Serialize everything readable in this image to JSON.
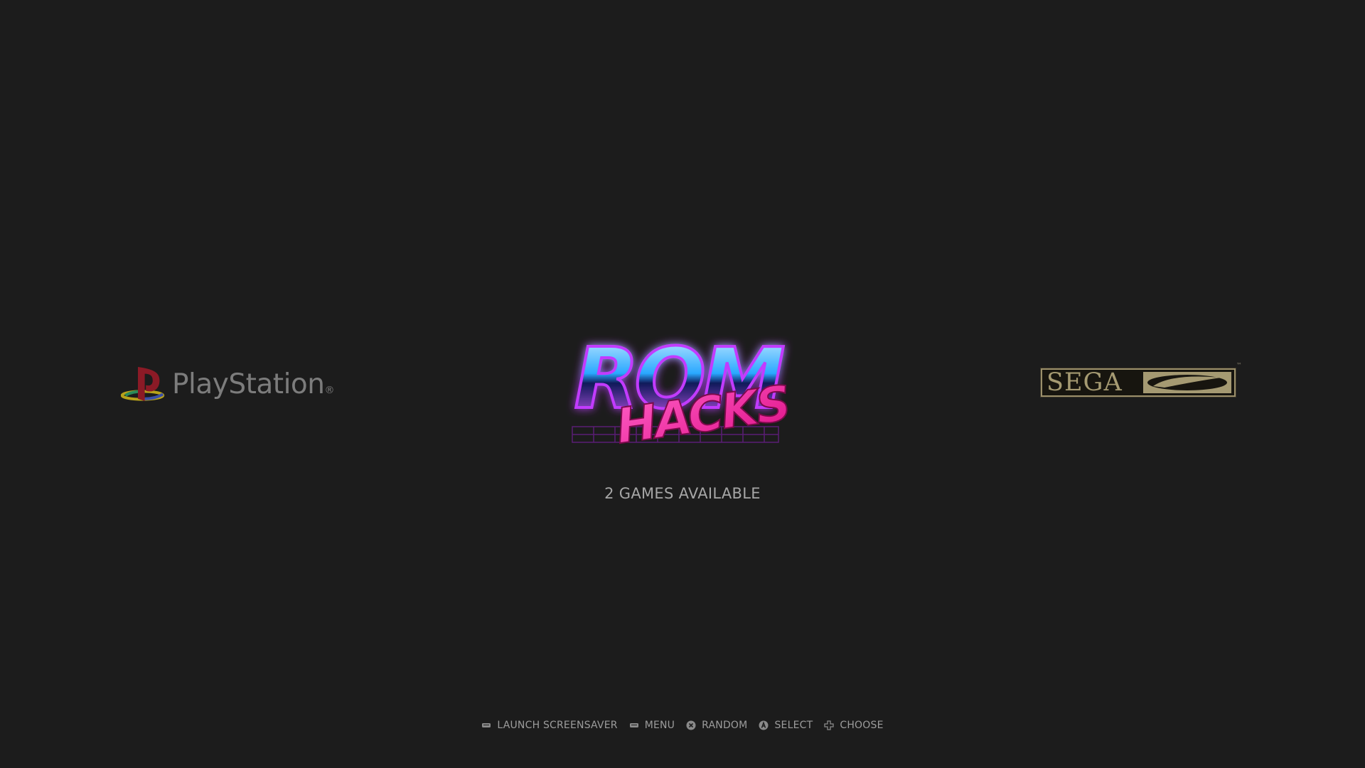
{
  "carousel": {
    "items": [
      {
        "name": "PlayStation",
        "wordmark": "PlayStation",
        "reg_mark": "®"
      },
      {
        "name": "ROM HACKS",
        "line1": "ROM",
        "line2": "HACKS"
      },
      {
        "name": "SEGA",
        "wordmark": "SEGA",
        "tm_mark": "™"
      }
    ],
    "selected_index": 1
  },
  "game_count": {
    "text": "2 GAMES AVAILABLE"
  },
  "help": {
    "items": [
      {
        "icon": "select-button-icon",
        "label": "LAUNCH SCREENSAVER"
      },
      {
        "icon": "start-button-icon",
        "label": "MENU"
      },
      {
        "icon": "x-button-icon",
        "label": "RANDOM"
      },
      {
        "icon": "a-button-icon",
        "label": "SELECT"
      },
      {
        "icon": "dpad-icon",
        "label": "CHOOSE"
      }
    ]
  },
  "colors": {
    "background": "#1c1c1c",
    "text": "#a6a6a6",
    "help_text": "#9c9c9c",
    "sega_gold": "#a59a72",
    "romhacks_pink": "#ff2fa8",
    "romhacks_blue": "#2aa8ff",
    "romhacks_purple": "#7a2cff"
  }
}
